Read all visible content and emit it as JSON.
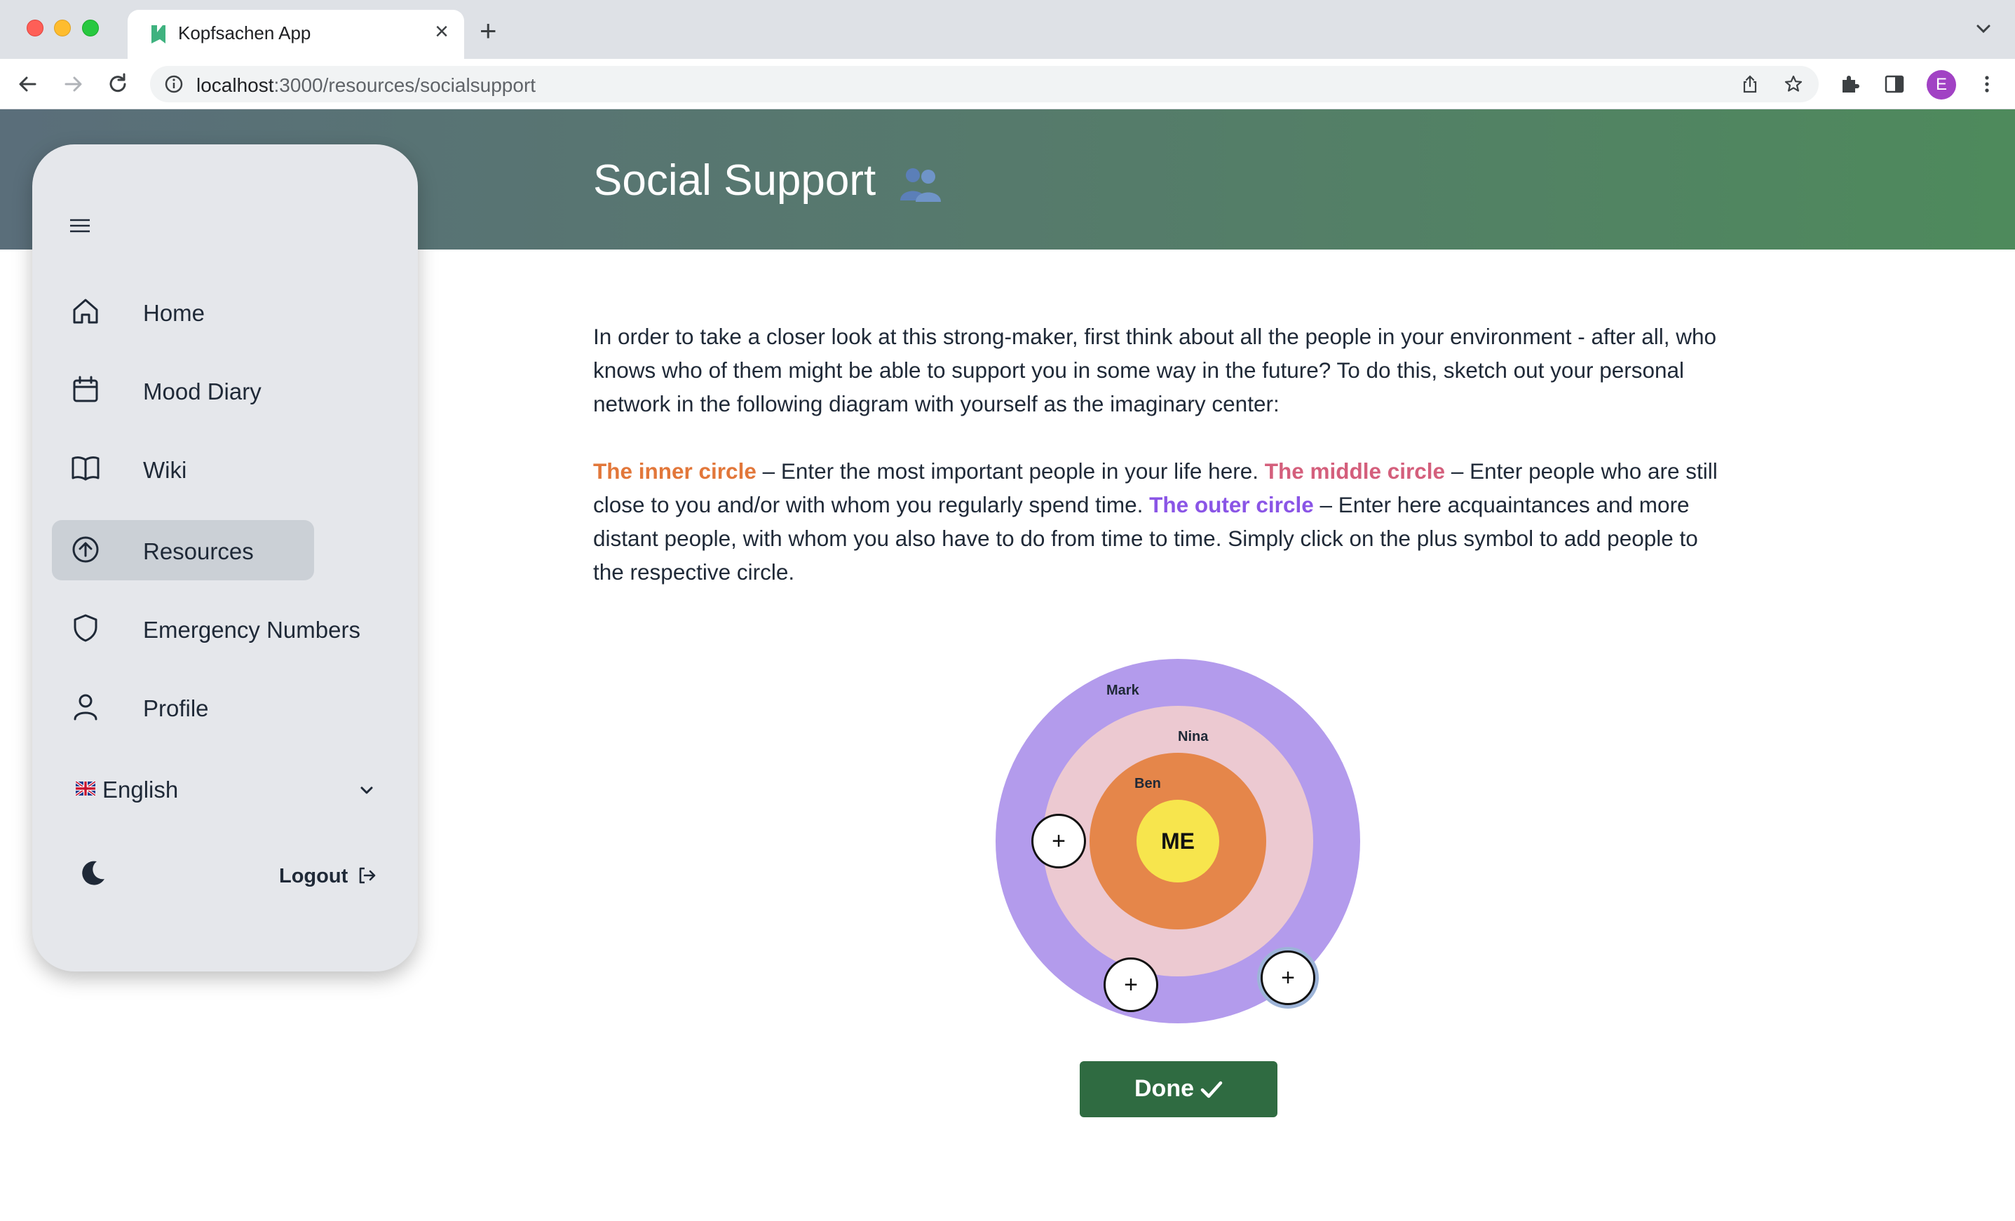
{
  "browser": {
    "tab_title": "Kopfsachen App",
    "url_host": "localhost",
    "url_path": ":3000/resources/socialsupport",
    "profile_initial": "E"
  },
  "header": {
    "title": "Social Support"
  },
  "sidebar": {
    "items": [
      {
        "label": "Home",
        "icon": "home-icon"
      },
      {
        "label": "Mood Diary",
        "icon": "calendar-icon"
      },
      {
        "label": "Wiki",
        "icon": "book-icon"
      },
      {
        "label": "Resources",
        "icon": "arrow-up-circle-icon",
        "active": true
      },
      {
        "label": "Emergency Numbers",
        "icon": "shield-icon"
      },
      {
        "label": "Profile",
        "icon": "user-icon"
      }
    ],
    "language": "English",
    "logout_label": "Logout"
  },
  "content": {
    "intro": "In order to take a closer look at this strong-maker, first think about all the people in your environment - after all, who knows who of them might be able to support you in some way in the future? To do this, sketch out your personal network in the following diagram with yourself as the imaginary center:",
    "inner_label": "The inner circle",
    "inner_text": " – Enter the most important people in your life here. ",
    "middle_label": "The middle circle",
    "middle_text": " – Enter people who are still close to you and/or with whom you regularly spend time. ",
    "outer_label": "The outer circle",
    "outer_text": " – Enter here acquaintances and more distant people, with whom you also have to do from time to time. Simply click on the plus symbol to add people to the respective circle."
  },
  "diagram": {
    "center_label": "ME",
    "outer_person": "Mark",
    "middle_person": "Nina",
    "inner_person": "Ben",
    "plus_symbol": "+",
    "colors": {
      "outer": "#b39bec",
      "middle": "#ecc9d1",
      "inner": "#e5864a",
      "center": "#f7e54d"
    }
  },
  "done_label": "Done",
  "colors": {
    "accent_green": "#2f6b41",
    "inner_text": "#e2773a",
    "middle_text": "#d45f7c",
    "outer_text": "#8a55e6"
  }
}
